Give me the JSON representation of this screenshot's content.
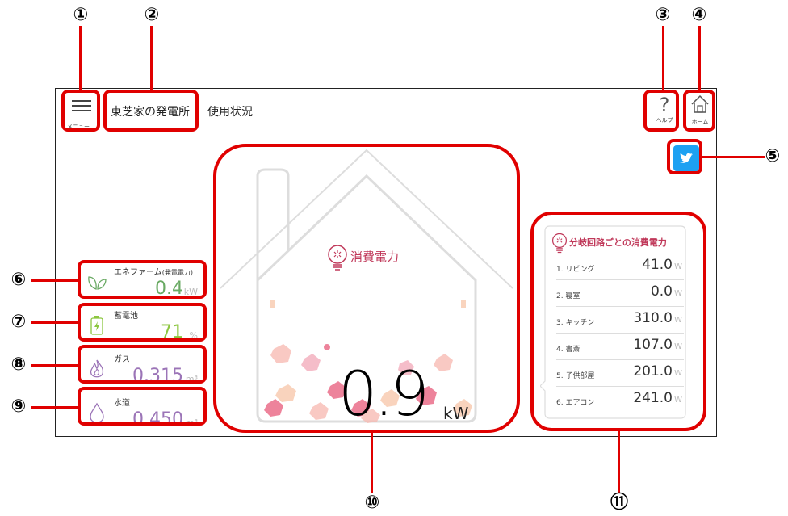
{
  "callouts": [
    "①",
    "②",
    "③",
    "④",
    "⑤",
    "⑥",
    "⑦",
    "⑧",
    "⑨",
    "⑩",
    "⑪"
  ],
  "header": {
    "menu_label": "メニュー",
    "site_title": "東芝家の発電所",
    "page_title": "使用状況",
    "help_label": "ヘルプ",
    "home_label": "ホーム"
  },
  "cards": {
    "enefarm": {
      "label": "エネファーム",
      "sub": "(発電電力)",
      "value": "0.4",
      "unit": "kW",
      "color": "#6aaa64"
    },
    "battery": {
      "label": "蓄電池",
      "value": "71",
      "unit": "%",
      "color": "#8cc63f"
    },
    "gas": {
      "label": "ガス",
      "value": "0.315",
      "unit": "m³",
      "color": "#9b74b7"
    },
    "water": {
      "label": "水道",
      "value": "0.450",
      "unit": "m³",
      "color": "#9b74b7"
    }
  },
  "consumption": {
    "label": "消費電力",
    "value": "0.9",
    "unit": "kW",
    "accent": "#c0395a"
  },
  "circuits": {
    "title": "分岐回路ごとの消費電力",
    "unit": "W",
    "items": [
      {
        "name": "1. リビング",
        "value": "41.0"
      },
      {
        "name": "2. 寝室",
        "value": "0.0"
      },
      {
        "name": "3. キッチン",
        "value": "310.0"
      },
      {
        "name": "4. 書斎",
        "value": "107.0"
      },
      {
        "name": "5. 子供部屋",
        "value": "201.0"
      },
      {
        "name": "6. エアコン",
        "value": "241.0"
      }
    ]
  }
}
